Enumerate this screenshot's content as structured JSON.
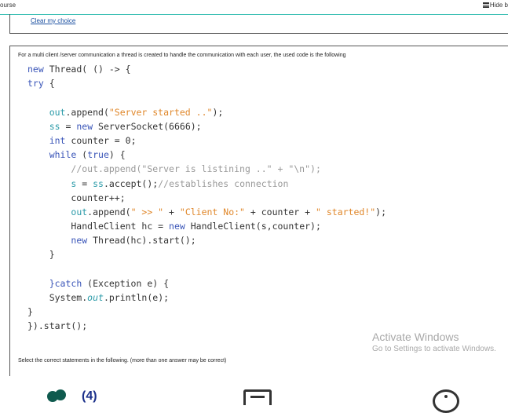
{
  "topbar": {
    "course": "ourse",
    "hide": "Hide b"
  },
  "previous_question": {
    "clear_link": "Clear my choice"
  },
  "question": {
    "intro": "For a multi client /server communication a thread is created to handle the communication with each user, the used code is the following",
    "code": [
      [
        [
          "kw",
          "new"
        ],
        [
          "p",
          " Thread( () -> {"
        ]
      ],
      [
        [
          "kw",
          "try"
        ],
        [
          "p",
          " {"
        ]
      ],
      [],
      [
        [
          "p",
          "    "
        ],
        [
          "var",
          "out"
        ],
        [
          "p",
          ".append("
        ],
        [
          "str",
          "\"Server started ..\""
        ],
        [
          "p",
          ");"
        ]
      ],
      [
        [
          "p",
          "    "
        ],
        [
          "var",
          "ss"
        ],
        [
          "p",
          " = "
        ],
        [
          "kw",
          "new"
        ],
        [
          "p",
          " ServerSocket(6666);"
        ]
      ],
      [
        [
          "p",
          "    "
        ],
        [
          "kw",
          "int"
        ],
        [
          "p",
          " counter = 0;"
        ]
      ],
      [
        [
          "p",
          "    "
        ],
        [
          "kw",
          "while"
        ],
        [
          "p",
          " ("
        ],
        [
          "kw",
          "true"
        ],
        [
          "p",
          ") {"
        ]
      ],
      [
        [
          "p",
          "        "
        ],
        [
          "cmt",
          "//out.append(\"Server is listining ..\" + \"\\n\");"
        ]
      ],
      [
        [
          "p",
          "        "
        ],
        [
          "var",
          "s"
        ],
        [
          "p",
          " = "
        ],
        [
          "var",
          "ss"
        ],
        [
          "p",
          ".accept();"
        ],
        [
          "cmt",
          "//establishes connection"
        ]
      ],
      [
        [
          "p",
          "        counter++;"
        ]
      ],
      [
        [
          "p",
          "        "
        ],
        [
          "var",
          "out"
        ],
        [
          "p",
          ".append("
        ],
        [
          "str",
          "\" >> \""
        ],
        [
          "p",
          " + "
        ],
        [
          "str",
          "\"Client No:\""
        ],
        [
          "p",
          " + counter + "
        ],
        [
          "str",
          "\" started!\""
        ],
        [
          "p",
          ");"
        ]
      ],
      [
        [
          "p",
          "        HandleClient hc = "
        ],
        [
          "kw",
          "new"
        ],
        [
          "p",
          " HandleClient(s,counter);"
        ]
      ],
      [
        [
          "p",
          "        "
        ],
        [
          "kw",
          "new"
        ],
        [
          "p",
          " Thread(hc).start();"
        ]
      ],
      [
        [
          "p",
          "    }"
        ]
      ],
      [],
      [
        [
          "p",
          "    "
        ],
        [
          "kw",
          "}catch"
        ],
        [
          "p",
          " (Exception e) {"
        ]
      ],
      [
        [
          "p",
          "    System."
        ],
        [
          "it",
          "out"
        ],
        [
          "p",
          ".println(e);"
        ]
      ],
      [
        [
          "p",
          "}"
        ]
      ],
      [
        [
          "p",
          "}).start();"
        ]
      ]
    ],
    "select_note": "Select the correct statements in the following. (more than one answer may be correct)"
  },
  "watermark": {
    "title": "Activate Windows",
    "subtitle": "Go to Settings to activate Windows."
  },
  "bottom_nav": {
    "badge": "(4)"
  },
  "icons": [
    "hide-icon",
    "people-icon",
    "document-icon",
    "info-icon"
  ]
}
